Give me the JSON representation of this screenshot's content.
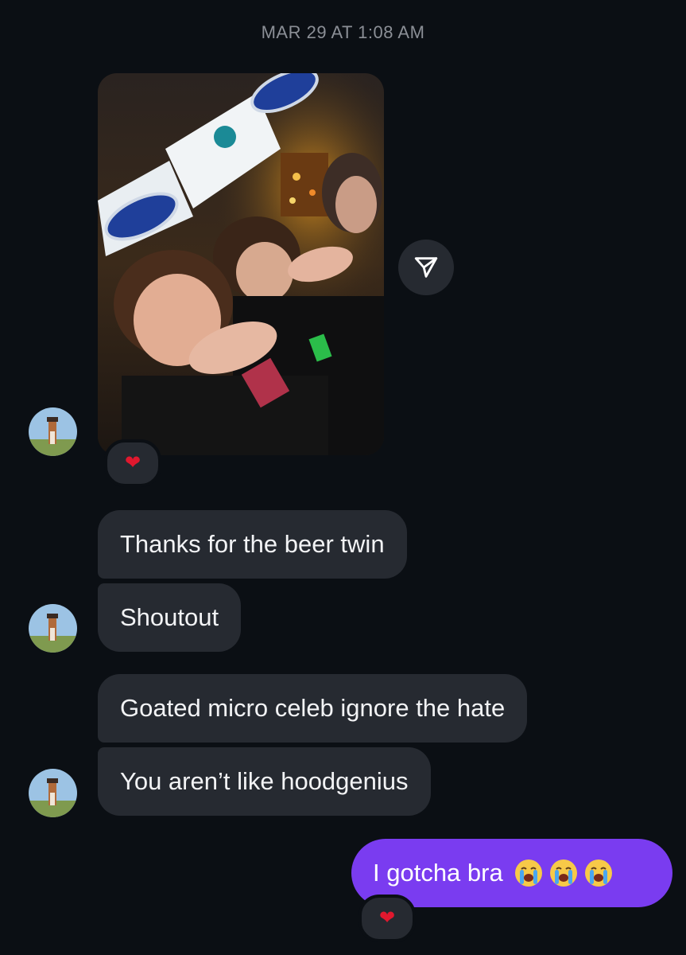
{
  "timestamp": "MAR 29 AT 1:08 AM",
  "photo_message": {
    "reaction": "❤",
    "share_icon": "send-paper-plane-icon"
  },
  "messages": [
    {
      "text": "Thanks for the beer twin",
      "side": "received"
    },
    {
      "text": "Shoutout",
      "side": "received"
    },
    {
      "text": "Goated micro celeb ignore the hate",
      "side": "received"
    },
    {
      "text": "You aren’t like hoodgenius",
      "side": "received"
    }
  ],
  "sent_message": {
    "text": "I gotcha bra",
    "emoji_count": 3,
    "emoji": "loudly-crying-face",
    "reaction": "❤"
  },
  "colors": {
    "background": "#0b0f14",
    "received_bubble": "#262a31",
    "sent_bubble": "#7a3cf0",
    "timestamp": "#8b8f96",
    "reaction_heart": "#e0182e"
  }
}
